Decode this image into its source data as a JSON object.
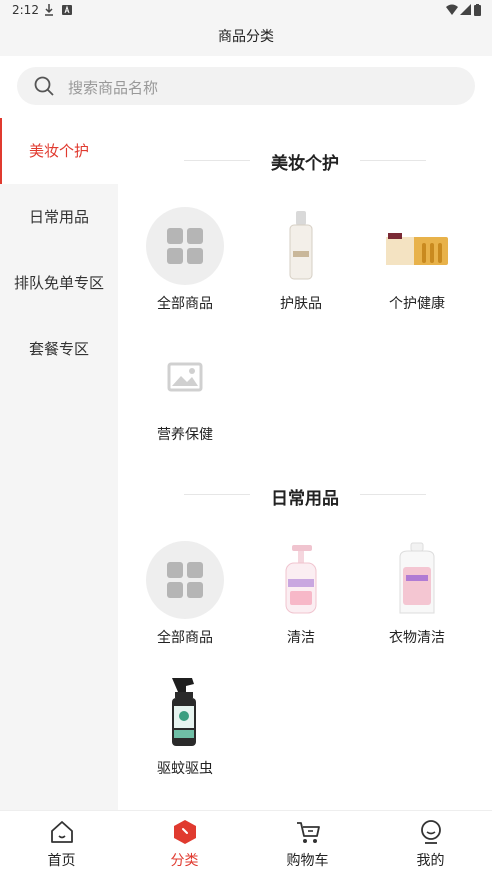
{
  "status_bar": {
    "time": "2:12"
  },
  "header": {
    "title": "商品分类"
  },
  "search": {
    "placeholder": "搜索商品名称"
  },
  "sidebar": {
    "items": [
      {
        "label": "美妆个护",
        "active": true
      },
      {
        "label": "日常用品",
        "active": false
      },
      {
        "label": "排队免单专区",
        "active": false
      },
      {
        "label": "套餐专区",
        "active": false
      }
    ]
  },
  "sections": [
    {
      "title": "美妆个护",
      "items": [
        {
          "label": "全部商品",
          "icon": "all-grid-icon"
        },
        {
          "label": "护肤品",
          "icon": "skincare-bottle-image"
        },
        {
          "label": "个护健康",
          "icon": "ampoule-box-image"
        },
        {
          "label": "营养保健",
          "icon": "image-placeholder-icon"
        }
      ]
    },
    {
      "title": "日常用品",
      "items": [
        {
          "label": "全部商品",
          "icon": "all-grid-icon"
        },
        {
          "label": "清洁",
          "icon": "pump-bottle-image"
        },
        {
          "label": "衣物清洁",
          "icon": "detergent-bottle-image"
        },
        {
          "label": "驱蚊驱虫",
          "icon": "spray-bottle-image"
        }
      ]
    }
  ],
  "tabbar": {
    "items": [
      {
        "label": "首页",
        "active": false
      },
      {
        "label": "分类",
        "active": true
      },
      {
        "label": "购物车",
        "active": false
      },
      {
        "label": "我的",
        "active": false
      }
    ]
  },
  "colors": {
    "accent": "#e03a2f",
    "sidebar_bg": "#f5f5f5",
    "search_bg": "#f2f2f2"
  }
}
